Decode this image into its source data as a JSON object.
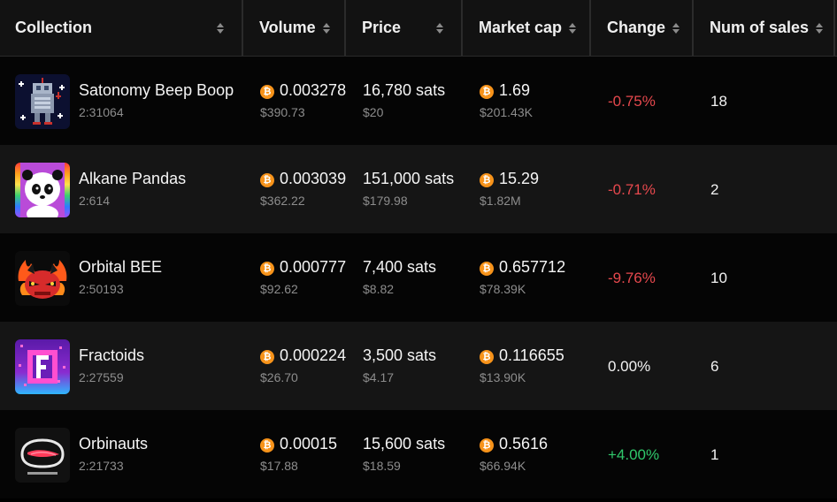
{
  "header": {
    "collection": "Collection",
    "volume": "Volume",
    "price": "Price",
    "market_cap": "Market cap",
    "change": "Change",
    "num_sales": "Num of sales"
  },
  "colors": {
    "negative": "#e5484d",
    "positive": "#30c86b",
    "btc": "#f7931a"
  },
  "rows": [
    {
      "name": "Satonomy Beep Boop",
      "id": "2:31064",
      "volume_btc": "0.003278",
      "volume_usd": "$390.73",
      "price_sats": "16,780 sats",
      "price_usd": "$20",
      "mcap_btc": "1.69",
      "mcap_usd": "$201.43K",
      "change": "-0.75%",
      "sales": "18",
      "icon": "robot-pixel-icon"
    },
    {
      "name": "Alkane Pandas",
      "id": "2:614",
      "volume_btc": "0.003039",
      "volume_usd": "$362.22",
      "price_sats": "151,000 sats",
      "price_usd": "$179.98",
      "mcap_btc": "15.29",
      "mcap_usd": "$1.82M",
      "change": "-0.71%",
      "sales": "2",
      "icon": "panda-icon"
    },
    {
      "name": "Orbital BEE",
      "id": "2:50193",
      "volume_btc": "0.000777",
      "volume_usd": "$92.62",
      "price_sats": "7,400 sats",
      "price_usd": "$8.82",
      "mcap_btc": "0.657712",
      "mcap_usd": "$78.39K",
      "change": "-9.76%",
      "sales": "10",
      "icon": "red-bee-icon"
    },
    {
      "name": "Fractoids",
      "id": "2:27559",
      "volume_btc": "0.000224",
      "volume_usd": "$26.70",
      "price_sats": "3,500 sats",
      "price_usd": "$4.17",
      "mcap_btc": "0.116655",
      "mcap_usd": "$13.90K",
      "change": "0.00%",
      "sales": "6",
      "icon": "fractoid-f-icon"
    },
    {
      "name": "Orbinauts",
      "id": "2:21733",
      "volume_btc": "0.00015",
      "volume_usd": "$17.88",
      "price_sats": "15,600 sats",
      "price_usd": "$18.59",
      "mcap_btc": "0.5616",
      "mcap_usd": "$66.94K",
      "change": "+4.00%",
      "sales": "1",
      "icon": "orbinauts-logo-icon"
    }
  ]
}
